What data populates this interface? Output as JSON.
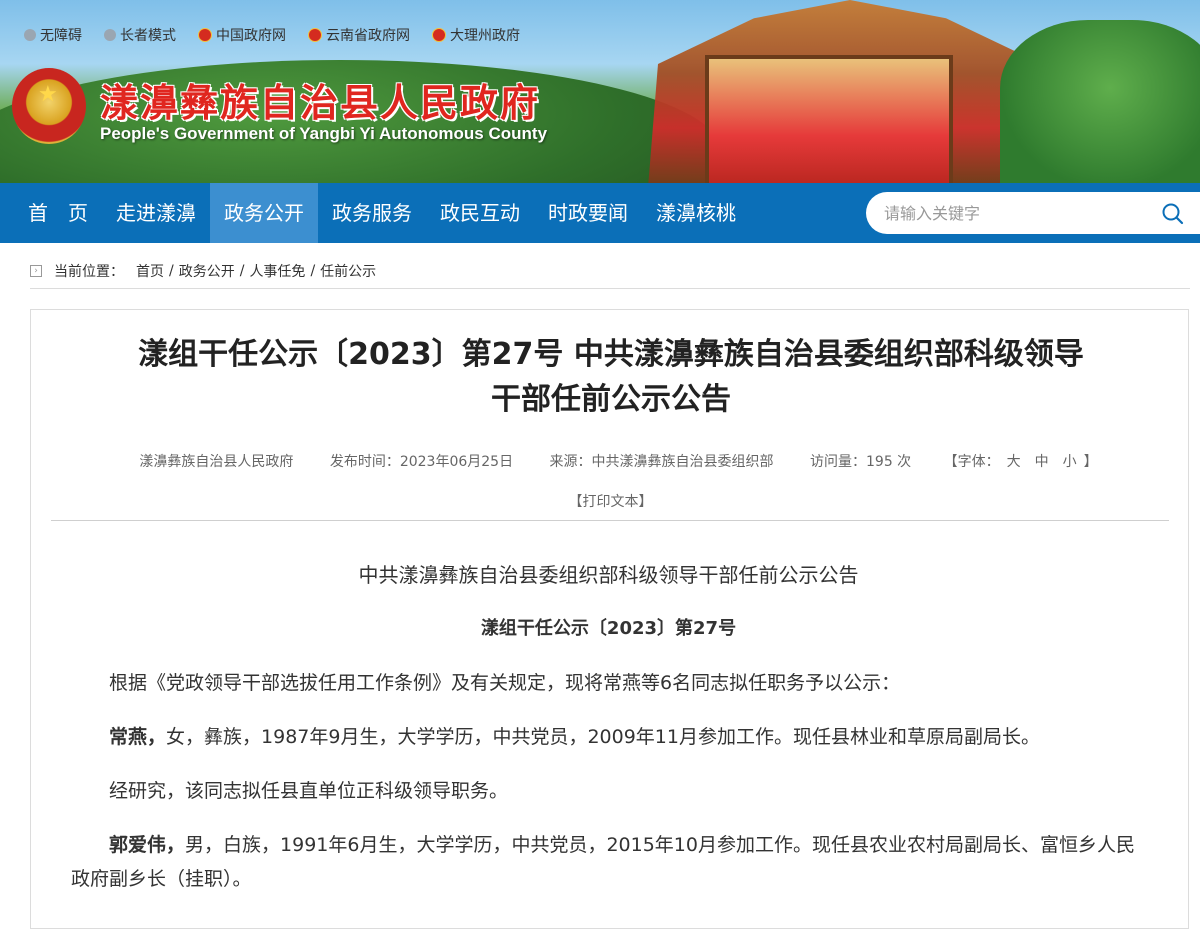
{
  "header": {
    "top_links": [
      {
        "label": "无障碍",
        "icon": "accessibility-icon"
      },
      {
        "label": "长者模式",
        "icon": "elder-mode-icon"
      },
      {
        "label": "中国政府网",
        "icon": "national-emblem-icon"
      },
      {
        "label": "云南省政府网",
        "icon": "national-emblem-icon"
      },
      {
        "label": "大理州政府",
        "icon": "national-emblem-icon"
      }
    ],
    "title": "漾濞彝族自治县人民政府",
    "subtitle": "People's Government of Yangbi Yi Autonomous County"
  },
  "nav": {
    "items": [
      "首　页",
      "走进漾濞",
      "政务公开",
      "政务服务",
      "政民互动",
      "时政要闻",
      "漾濞核桃"
    ],
    "active": "政务公开"
  },
  "search": {
    "placeholder": "请输入关键字",
    "icon": "search-icon"
  },
  "breadcrumb": {
    "label": "当前位置：",
    "items": [
      "首页",
      "政务公开",
      "人事任免",
      "任前公示"
    ]
  },
  "article": {
    "title_line1": "漾组干任公示〔2023〕第27号 中共漾濞彝族自治县委组织部科级领导",
    "title_line2": "干部任前公示公告",
    "meta": {
      "publisher": "漾濞彝族自治县人民政府",
      "date": "发布时间：2023年06月25日",
      "source": "来源：中共漾濞彝族自治县委组织部",
      "views": "访问量：195 次",
      "font_label": "【字体：",
      "font_large": "大",
      "font_medium": "中",
      "font_small": "小",
      "font_close": "】"
    },
    "print": "【打印文本】",
    "doc_heading": "中共漾濞彝族自治县委组织部科级领导干部任前公示公告",
    "doc_number": "漾组干任公示〔2023〕第27号",
    "intro": "根据《党政领导干部选拔任用工作条例》及有关规定，现将常燕等6名同志拟任职务予以公示：",
    "person1_name": "常燕，",
    "person1_desc": "女，彝族，1987年9月生，大学学历，中共党员，2009年11月参加工作。现任县林业和草原局副局长。",
    "person1_plan": "经研究，该同志拟任县直单位正科级领导职务。",
    "person2_name": "郭爱伟，",
    "person2_desc": "男，白族，1991年6月生，大学学历，中共党员，2015年10月参加工作。现任县农业农村局副局长、富恒乡人民政府副乡长（挂职）。"
  }
}
